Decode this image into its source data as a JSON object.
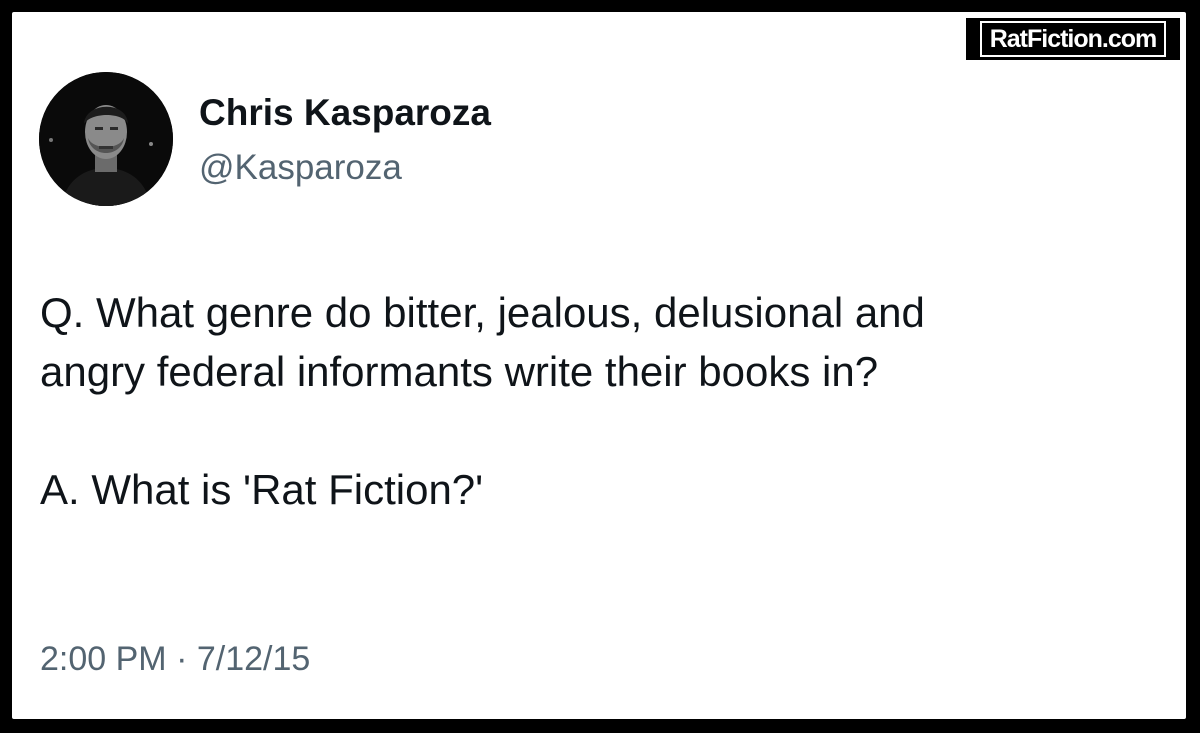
{
  "watermark": {
    "text": "RatFiction.com"
  },
  "author": {
    "display_name": "Chris Kasparoza",
    "handle": "@Kasparoza"
  },
  "tweet": {
    "line_1": "Q. What genre do bitter, jealous, delusional and",
    "line_2": "angry federal informants write their books in?",
    "line_3": "A. What is 'Rat Fiction?'"
  },
  "meta": {
    "timestamp": "2:00 PM · 7/12/15"
  },
  "colors": {
    "frame": "#000000",
    "card_background": "#ffffff",
    "primary_text": "#0f1419",
    "secondary_text": "#536471"
  }
}
